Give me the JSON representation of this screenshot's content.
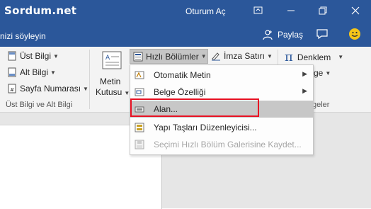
{
  "titlebar": {
    "logo_text": "Sordum.net",
    "signin_label": "Oturum Aç",
    "bg_color": "#2b579a"
  },
  "tellbar": {
    "tell_me_text": "nizi söyleyin",
    "share_label": "Paylaş"
  },
  "ribbon": {
    "header_group": {
      "header_label": "Üst Bilgi",
      "footer_label": "Alt Bilgi",
      "page_number_label": "Sayfa Numarası",
      "group_label": "Üst Bilgi ve Alt Bilgi"
    },
    "text_group": {
      "textbox_label_1": "Metin",
      "textbox_label_2": "Kutusu",
      "quick_parts_label": "Hızlı Bölümler",
      "signature_line_label": "İmza Satırı",
      "group_label_partial": "geler"
    },
    "symbols_group": {
      "equation_label": "Denklem",
      "symbol_partial": "ge"
    }
  },
  "quick_parts_menu": {
    "items": [
      {
        "label": "Otomatik Metin",
        "icon": "autotext-icon",
        "has_submenu": true,
        "enabled": true
      },
      {
        "label": "Belge Özelliği",
        "icon": "document-property-icon",
        "has_submenu": true,
        "enabled": true
      },
      {
        "label": "Alan...",
        "icon": "field-icon",
        "has_submenu": false,
        "enabled": true,
        "highlighted": true
      },
      {
        "label": "Yapı Taşları Düzenleyicisi...",
        "icon": "building-blocks-icon",
        "has_submenu": false,
        "enabled": true
      },
      {
        "label": "Seçimi Hızlı Bölüm Galerisine Kaydet...",
        "icon": "save-selection-icon",
        "has_submenu": false,
        "enabled": false
      }
    ]
  },
  "colors": {
    "highlight": "#c7c7c7",
    "annotation_box": "#e81123",
    "ribbon_bg": "#f3f3f3"
  }
}
